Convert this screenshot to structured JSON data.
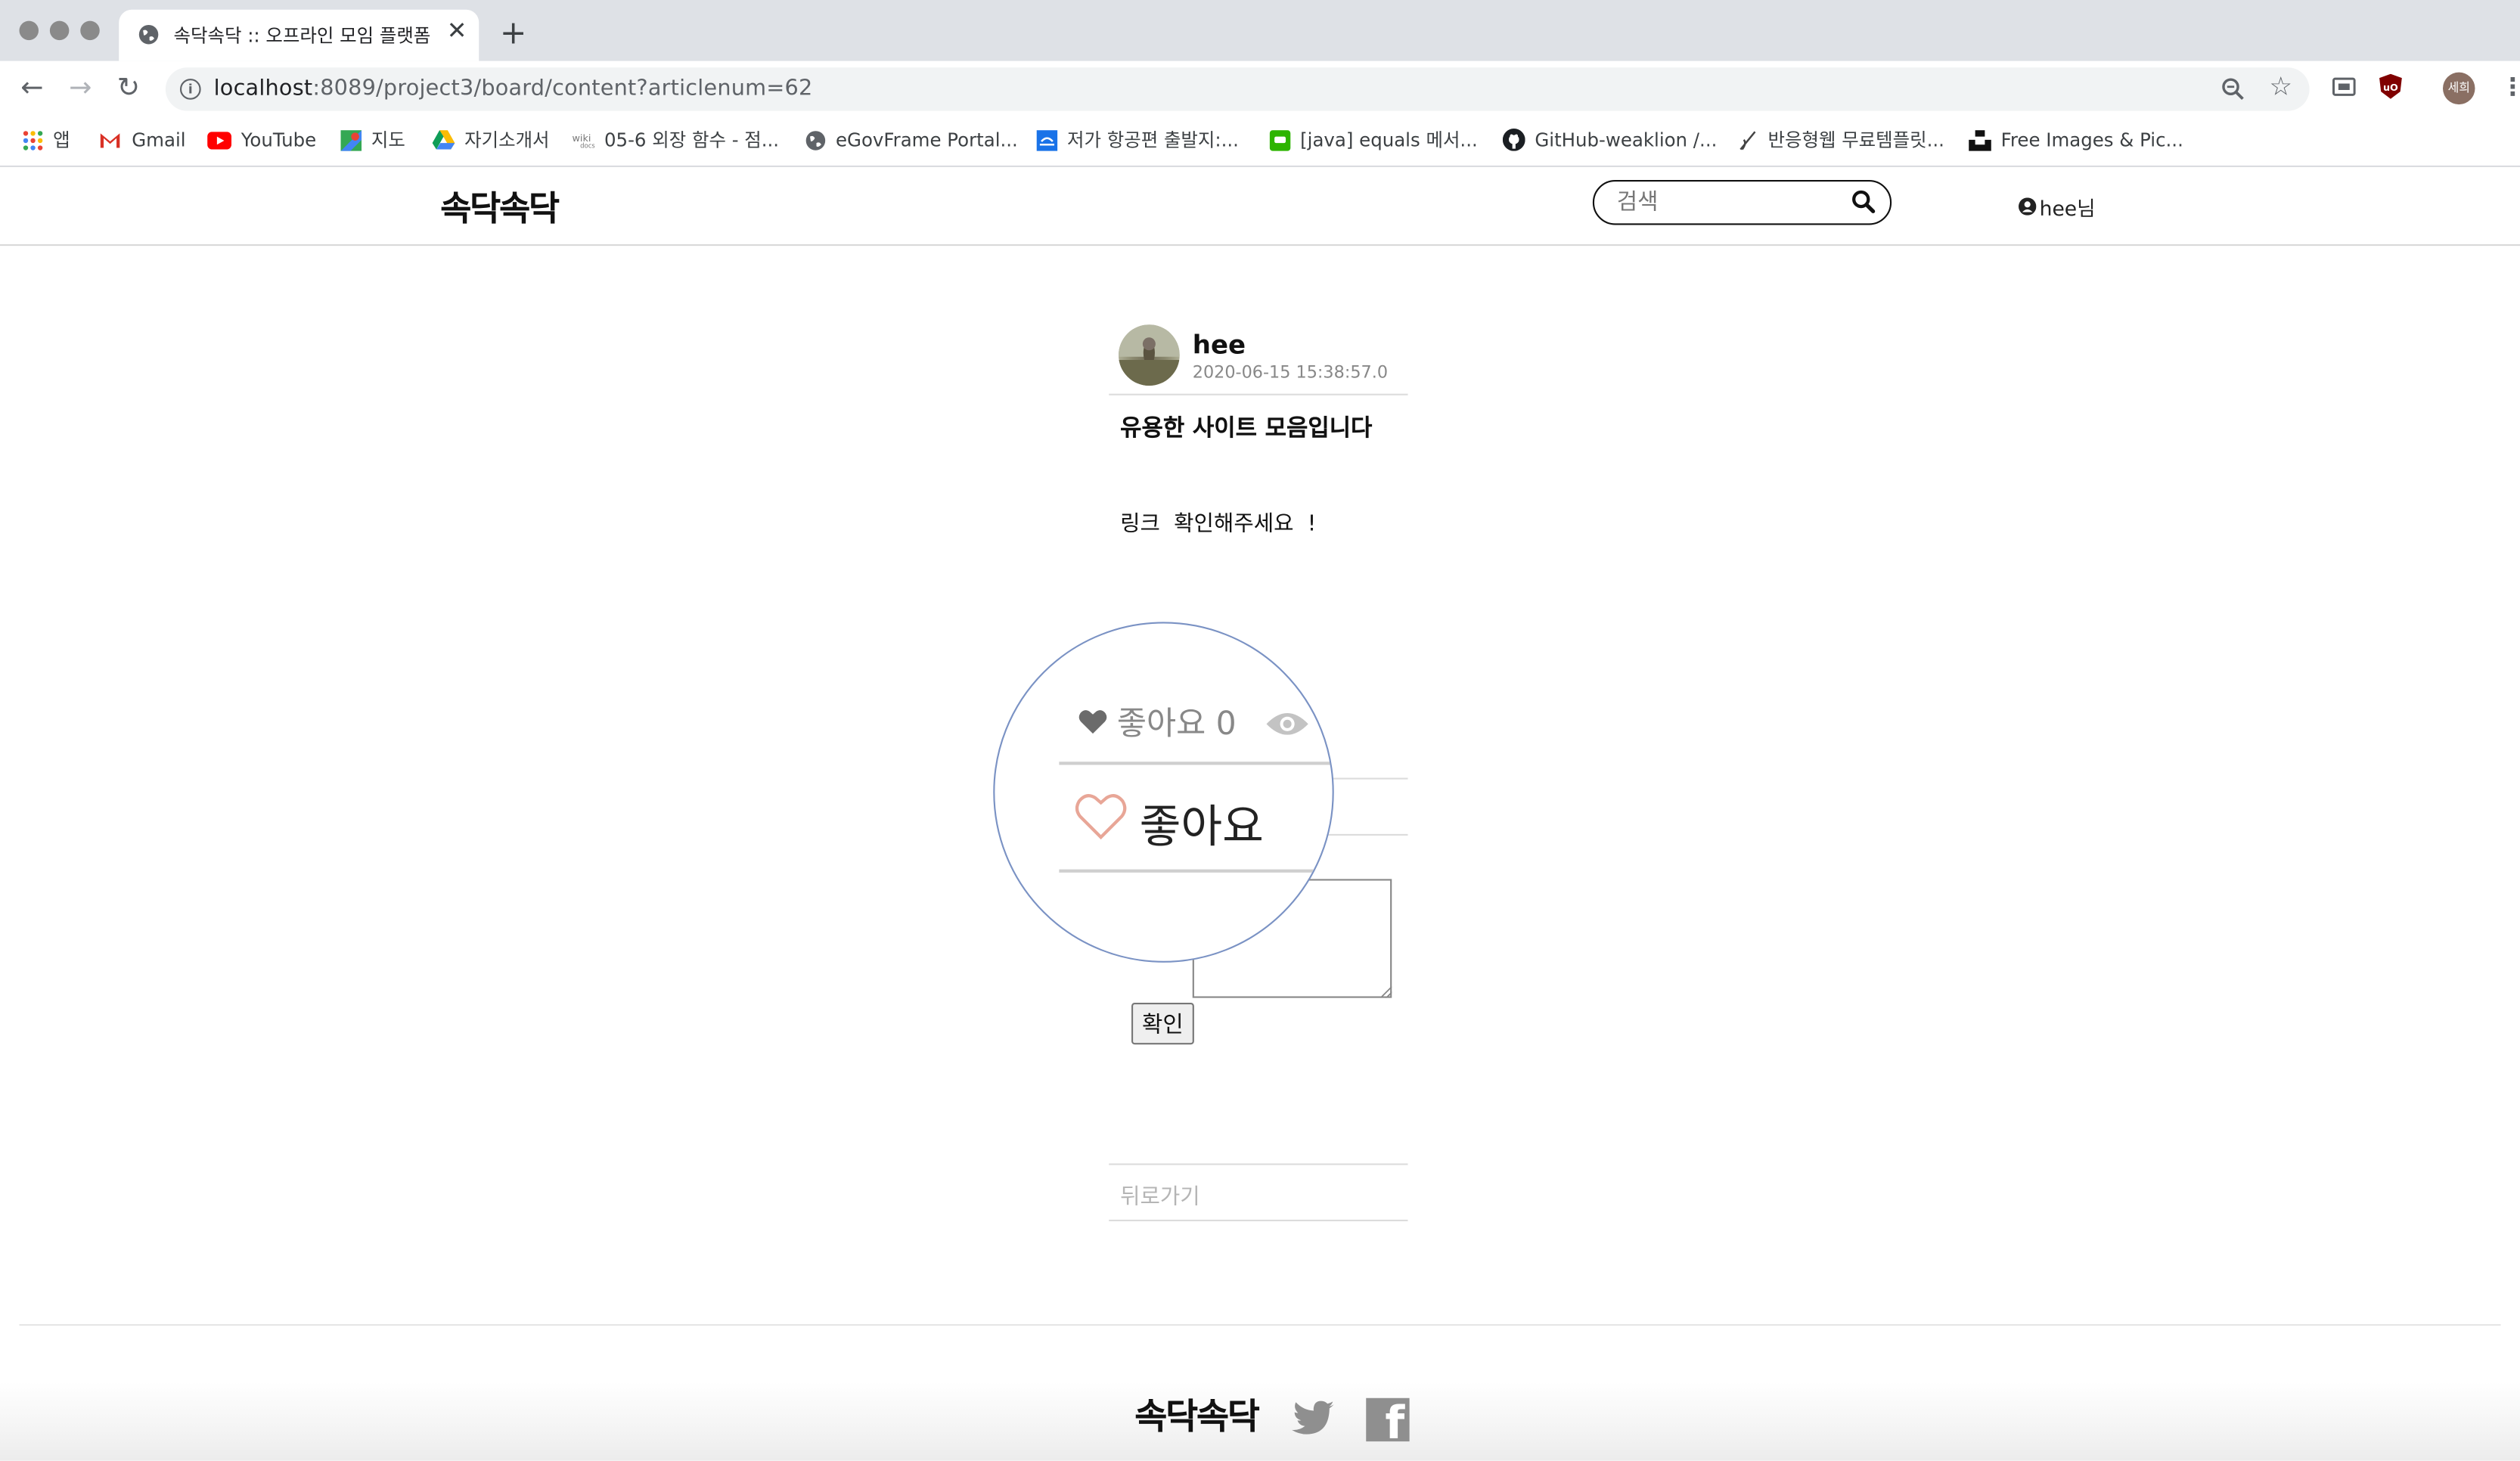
{
  "browser": {
    "tab_title": "속닥속닥 :: 오프라인 모임 플랫폼",
    "url_host": "localhost",
    "url_rest": ":8089/project3/board/content?articlenum=62",
    "profile_label": "세희",
    "bookmarks": [
      {
        "label": "앱",
        "icon": "apps-grid-icon"
      },
      {
        "label": "Gmail",
        "icon": "gmail-icon"
      },
      {
        "label": "YouTube",
        "icon": "youtube-icon"
      },
      {
        "label": "지도",
        "icon": "maps-icon"
      },
      {
        "label": "자기소개서",
        "icon": "drive-icon"
      },
      {
        "label": "05-6 외장 함수 - 점...",
        "icon": "wikidocs-icon"
      },
      {
        "label": "eGovFrame Portal...",
        "icon": "globe-icon"
      },
      {
        "label": "저가 항공편 출발지:...",
        "icon": "flight-icon"
      },
      {
        "label": "[java] equals 메서...",
        "icon": "chat-icon"
      },
      {
        "label": "GitHub-weaklion /...",
        "icon": "github-icon"
      },
      {
        "label": "반응형웹 무료템플릿...",
        "icon": "pen-icon"
      },
      {
        "label": "Free Images & Pic...",
        "icon": "unsplash-icon"
      }
    ]
  },
  "site": {
    "logo": "속닥속닥",
    "search_placeholder": "검색",
    "user_label": "hee님"
  },
  "article": {
    "author": "hee",
    "date": "2020-06-15 15:38:57.0",
    "title": "유용한 사이트 모음입니다",
    "body": "링크  확인해주세요  !"
  },
  "magnifier": {
    "like_count_label": "좋아요 0",
    "like_button_label": "좋아요"
  },
  "comment": {
    "confirm_label": "확인"
  },
  "back_label": "뒤로가기",
  "footer": {
    "logo": "속닥속닥"
  }
}
